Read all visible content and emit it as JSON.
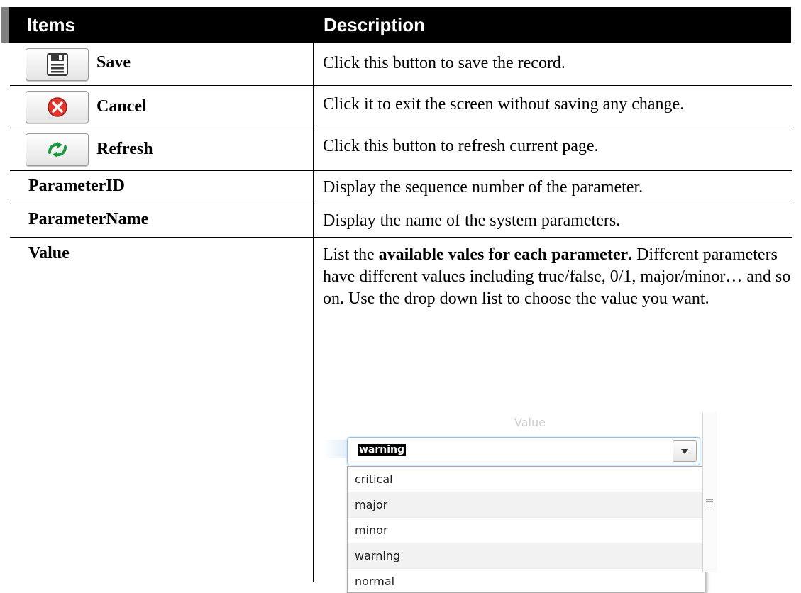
{
  "header": {
    "items": "Items",
    "description": "Description"
  },
  "rows": [
    {
      "item": "Save",
      "icon": "save-icon",
      "description": "Click this button to save the record."
    },
    {
      "item": "Cancel",
      "icon": "cancel-icon",
      "description": "Click it to exit the screen without saving any change."
    },
    {
      "item": "Refresh",
      "icon": "refresh-icon",
      "description": "Click this button to refresh current page."
    },
    {
      "item": "ParameterID",
      "description": "Display the sequence number of the parameter."
    },
    {
      "item": "ParameterName",
      "description": "Display the name of the system parameters."
    },
    {
      "item": "Value",
      "description_lead": "List the ",
      "description_bold": "available vales for each parameter",
      "description_tail": ". Different parameters have different values including true/false, 0/1, major/minor… and so on. Use the drop down list to choose the value you want."
    }
  ],
  "dropdown": {
    "column_header": "Value",
    "selected": "warning",
    "options": [
      "critical",
      "major",
      "minor",
      "warning",
      "normal"
    ],
    "hidden_value": "false"
  },
  "colors": {
    "header_bg": "#000000",
    "header_text": "#ffffff",
    "cancel_red": "#e0382f",
    "refresh_green": "#1a9a3e"
  }
}
